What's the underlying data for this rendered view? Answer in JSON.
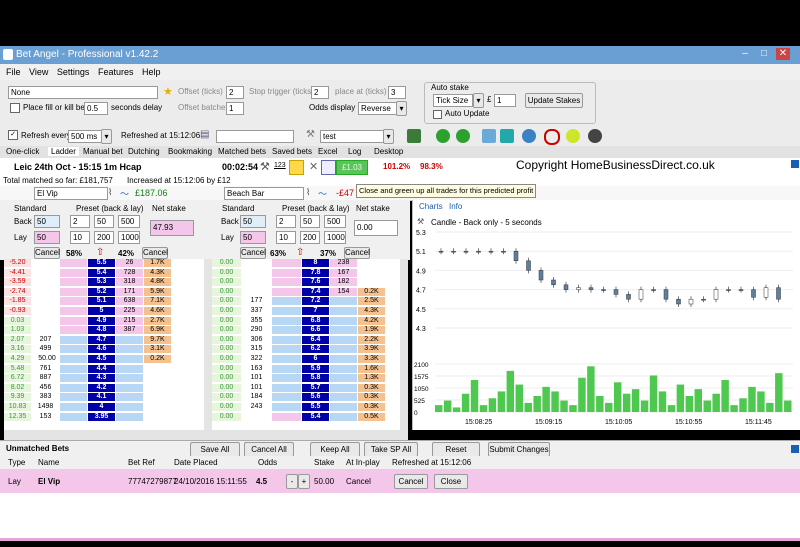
{
  "window": {
    "title": "Bet Angel - Professional v1.42.2"
  },
  "menu": [
    "File",
    "View",
    "Settings",
    "Features",
    "Help"
  ],
  "toolbar": {
    "market_select": "None",
    "offset_ticks_label": "Offset (ticks)",
    "offset_ticks_value": "2",
    "stop_trigger_label": "Stop trigger (ticks)",
    "stop_trigger_value": "2",
    "place_at_label": "place at (ticks)",
    "place_at_value": "3",
    "fill_kill_label": "Place fill or kill bets",
    "fill_kill_value": "0.5",
    "seconds_delay_label": "seconds delay",
    "offset_batches_label": "Offset batches",
    "offset_batches_value": "1",
    "odds_display_label": "Odds display",
    "odds_display_value": "Reverse",
    "auto_stake_label": "Auto stake",
    "tick_size_value": "Tick Size",
    "currency": "£",
    "tick_stake_value": "1",
    "update_stakes_label": "Update Stakes",
    "auto_update_label": "Auto Update"
  },
  "toolbar2": {
    "refresh_label": "Refresh every",
    "refresh_value": "500 ms",
    "refreshed_at": "Refreshed at 15:12:06",
    "profile_value": "test"
  },
  "tabs": [
    "One-click",
    "Ladder",
    "Manual bet",
    "Dutching",
    "Bookmaking",
    "Matched bets",
    "Saved bets",
    "Excel",
    "Log",
    "Desktop"
  ],
  "market": {
    "name": "Leic 24th Oct - 15:15 1m Hcap",
    "countdown": "00:02:54",
    "num": "123",
    "green_amount": "£1.03",
    "pct1": "101.2%",
    "pct2": "98.3%",
    "total_matched": "Total matched so far: £181,757",
    "increased": "Increased at 15:12:06 by £12",
    "copyright": "Copyright HomeBusinessDirect.co.uk",
    "tooltip": "Close and green up all trades for this predicted profit"
  },
  "runners": [
    {
      "name": "El Vip",
      "pl": "£187.06",
      "pct_left": "58%",
      "pct_right": "42%",
      "net_stake_label": "Net stake",
      "net_stake": "47.93"
    },
    {
      "name": "Beach Bar",
      "pl": "-£47",
      "pct_left": "63%",
      "pct_right": "37%",
      "net_stake_label": "Net stake",
      "net_stake": "0.00"
    }
  ],
  "stakes": {
    "standard": "Standard",
    "preset": "Preset (back & lay)",
    "back": "Back",
    "lay": "Lay",
    "back_vals": [
      "50",
      "2",
      "50",
      "500"
    ],
    "lay_vals": [
      "50",
      "10",
      "200",
      "1000"
    ],
    "cancel": "Cancel"
  },
  "ladder1": [
    {
      "pl": "-5.20",
      "vol": "",
      "odds": "5.5",
      "lay": "26",
      "lv": "1.7K"
    },
    {
      "pl": "-4.41",
      "vol": "",
      "odds": "5.4",
      "lay": "728",
      "lv": "4.3K"
    },
    {
      "pl": "-3.59",
      "vol": "",
      "odds": "5.3",
      "lay": "318",
      "lv": "4.8K"
    },
    {
      "pl": "-2.74",
      "vol": "",
      "odds": "5.2",
      "lay": "171",
      "lv": "5.9K"
    },
    {
      "pl": "-1.85",
      "vol": "",
      "odds": "5.1",
      "lay": "638",
      "lv": "7.1K"
    },
    {
      "pl": "-0.93",
      "vol": "",
      "odds": "5",
      "lay": "225",
      "lv": "4.6K"
    },
    {
      "pl": "0.03",
      "vol": "",
      "odds": "4.9",
      "lay": "215",
      "lv": "2.7K"
    },
    {
      "pl": "1.03",
      "vol": "",
      "odds": "4.8",
      "lay": "387",
      "lv": "6.9K"
    },
    {
      "pl": "2.07",
      "vol": "207",
      "odds": "4.7",
      "lay": "",
      "lv": "9.7K"
    },
    {
      "pl": "3.16",
      "vol": "499",
      "odds": "4.6",
      "lay": "",
      "lv": "3.1K"
    },
    {
      "pl": "4.29",
      "vol": "485",
      "odds": "4.5",
      "lay": "",
      "lv": "0.2K"
    },
    {
      "pl": "5.48",
      "vol": "761",
      "odds": "4.4",
      "lay": "",
      "lv": ""
    },
    {
      "pl": "6.72",
      "vol": "887",
      "odds": "4.3",
      "lay": "",
      "lv": ""
    },
    {
      "pl": "8.02",
      "vol": "456",
      "odds": "4.2",
      "lay": "",
      "lv": ""
    },
    {
      "pl": "9.39",
      "vol": "383",
      "odds": "4.1",
      "lay": "",
      "lv": ""
    },
    {
      "pl": "10.83",
      "vol": "1498",
      "odds": "4",
      "lay": "",
      "lv": ""
    },
    {
      "pl": "12.35",
      "vol": "153",
      "odds": "3.95",
      "lay": "",
      "lv": ""
    }
  ],
  "ladder1_extra": "50.00",
  "ladder2": [
    {
      "pl": "0.00",
      "vol": "",
      "odds": "8",
      "lay": "238",
      "lv": ""
    },
    {
      "pl": "0.00",
      "vol": "",
      "odds": "7.8",
      "lay": "167",
      "lv": ""
    },
    {
      "pl": "0.00",
      "vol": "",
      "odds": "7.6",
      "lay": "182",
      "lv": ""
    },
    {
      "pl": "0.00",
      "vol": "",
      "odds": "7.4",
      "lay": "154",
      "lv": "0.2K"
    },
    {
      "pl": "0.00",
      "vol": "177",
      "odds": "7.2",
      "lay": "",
      "lv": "2.5K"
    },
    {
      "pl": "0.00",
      "vol": "337",
      "odds": "7",
      "lay": "",
      "lv": "4.3K"
    },
    {
      "pl": "0.00",
      "vol": "355",
      "odds": "6.8",
      "lay": "",
      "lv": "4.2K"
    },
    {
      "pl": "0.00",
      "vol": "290",
      "odds": "6.6",
      "lay": "",
      "lv": "1.9K"
    },
    {
      "pl": "0.00",
      "vol": "306",
      "odds": "6.4",
      "lay": "",
      "lv": "2.2K"
    },
    {
      "pl": "0.00",
      "vol": "315",
      "odds": "6.2",
      "lay": "",
      "lv": "3.9K"
    },
    {
      "pl": "0.00",
      "vol": "322",
      "odds": "6",
      "lay": "",
      "lv": "3.3K"
    },
    {
      "pl": "0.00",
      "vol": "163",
      "odds": "5.9",
      "lay": "",
      "lv": "1.6K"
    },
    {
      "pl": "0.00",
      "vol": "101",
      "odds": "5.8",
      "lay": "",
      "lv": "1.3K"
    },
    {
      "pl": "0.00",
      "vol": "101",
      "odds": "5.7",
      "lay": "",
      "lv": "0.3K"
    },
    {
      "pl": "0.00",
      "vol": "184",
      "odds": "5.6",
      "lay": "",
      "lv": "0.3K"
    },
    {
      "pl": "0.00",
      "vol": "243",
      "odds": "5.5",
      "lay": "",
      "lv": "0.3K"
    },
    {
      "pl": "0.00",
      "vol": "",
      "odds": "5.4",
      "lay": "",
      "lv": "0.5K"
    }
  ],
  "chart": {
    "tabs": [
      "Charts",
      "Info"
    ],
    "title": "Candle - Back only - 5 seconds",
    "y_ticks": [
      "5.3",
      "5.1",
      "4.9",
      "4.7",
      "4.5",
      "4.3"
    ],
    "vol_ticks": [
      "2100",
      "1575",
      "1050",
      "525",
      "0"
    ],
    "x_ticks": [
      "15:08:25",
      "15:09:15",
      "15:10:05",
      "15:10:55",
      "15:11:45"
    ]
  },
  "chart_data": {
    "type": "line",
    "title": "Candle - Back only - 5 seconds",
    "ylim": [
      4.3,
      5.3
    ],
    "x": [
      "15:08:25",
      "15:09:15",
      "15:10:05",
      "15:10:55",
      "15:11:45"
    ],
    "series": [
      {
        "values": [
          5.1,
          5.1,
          4.8,
          4.7,
          4.6,
          4.7
        ]
      }
    ],
    "volume_ylim": [
      0,
      2100
    ]
  },
  "unmatched": {
    "title": "Unmatched Bets",
    "buttons": [
      "Save All",
      "Cancel All",
      "Keep All",
      "Take SP All",
      "Reset",
      "Submit Changes"
    ],
    "headers": [
      "Type",
      "Name",
      "Bet Ref",
      "Date Placed",
      "Odds",
      "Stake",
      "At In-play",
      "Refreshed at 15:12:06"
    ],
    "bet": {
      "type": "Lay",
      "name": "El Vip",
      "ref": "77747279877",
      "date": "24/10/2016 15:11:55",
      "odds": "4.5",
      "stake": "50.00",
      "inplay": "Cancel",
      "cancel_btn": "Cancel",
      "close_btn": "Close"
    }
  },
  "colors": {
    "back": "#b7d7f5",
    "lay": "#f3c6ea",
    "odds": "#0000a8",
    "green": "#4fc84f",
    "orange": "#f5c28f"
  }
}
